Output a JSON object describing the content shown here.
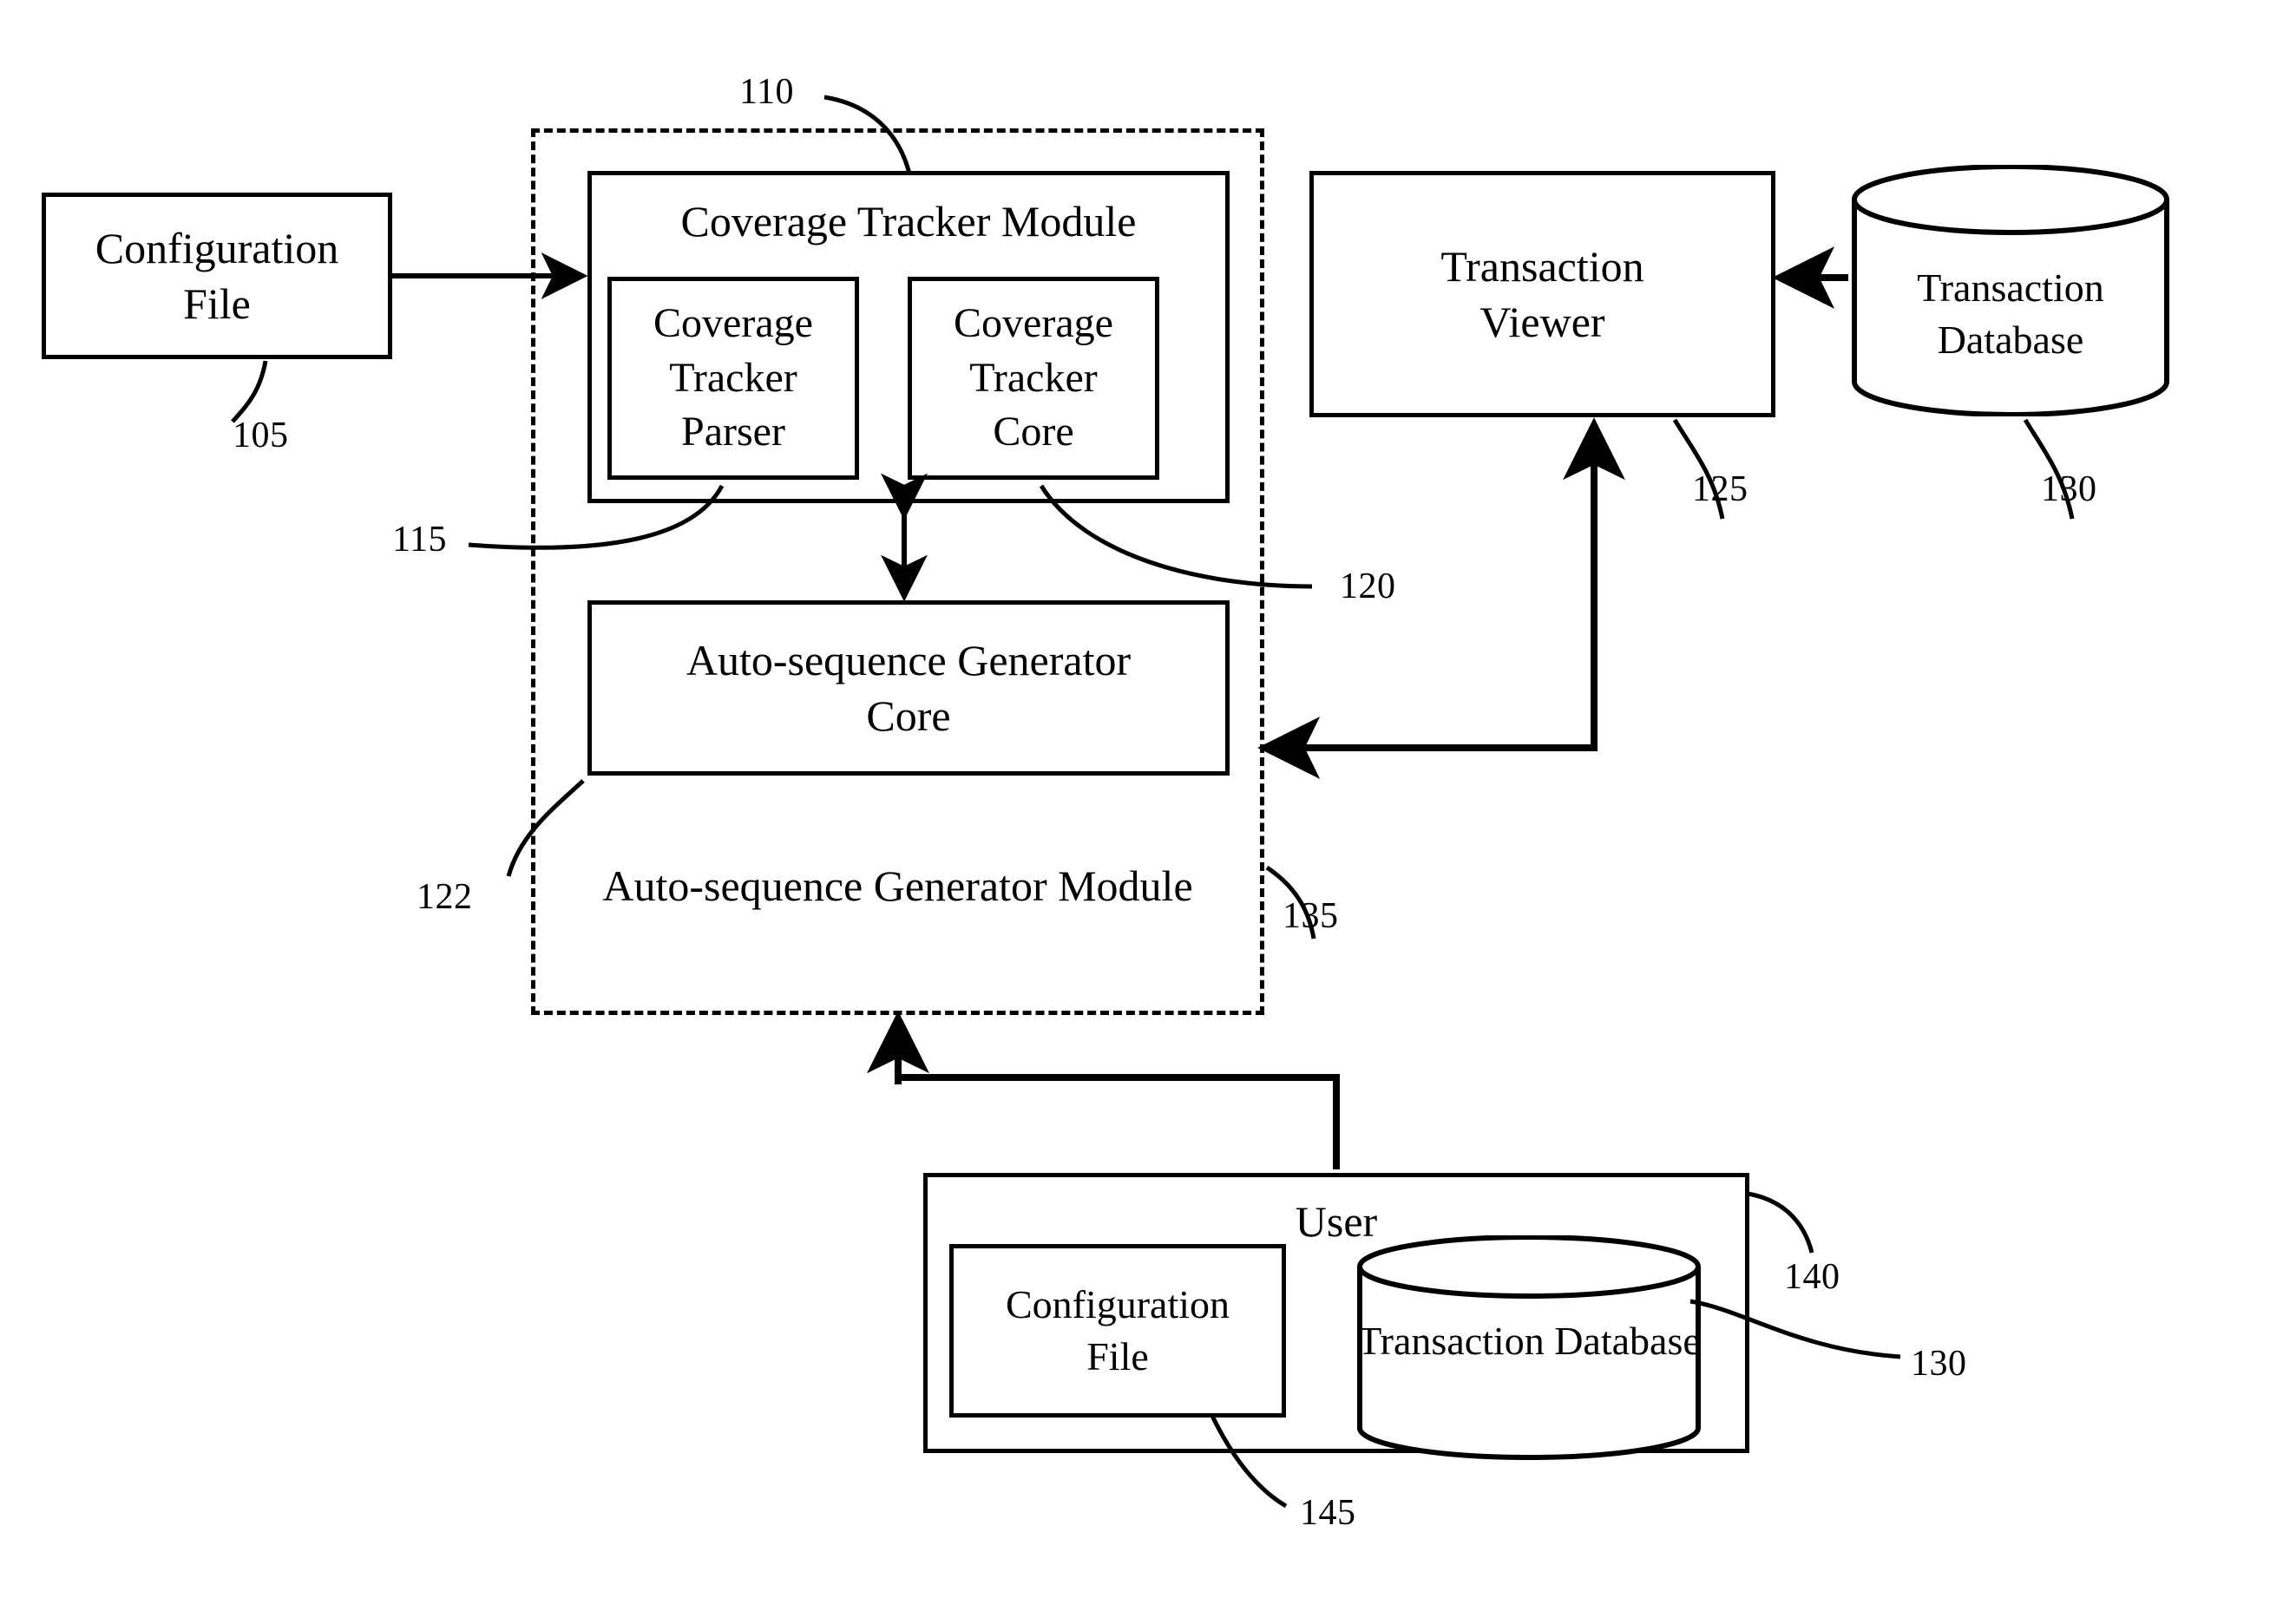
{
  "figure": {
    "type": "patent-block-diagram",
    "background": "#ffffff",
    "stroke": "#000000"
  },
  "blocks": {
    "configuration_file_left": {
      "label": "Configuration\nFile",
      "ref": "105"
    },
    "coverage_tracker_module": {
      "label": "Coverage Tracker Module",
      "ref": "110"
    },
    "coverage_tracker_parser": {
      "label": "Coverage\nTracker\nParser",
      "ref": "115"
    },
    "coverage_tracker_core": {
      "label": "Coverage\nTracker\nCore",
      "ref": "120"
    },
    "auto_sequence_generator_core": {
      "label": "Auto-sequence Generator\nCore",
      "ref": "122"
    },
    "auto_sequence_generator_module": {
      "label": "Auto-sequence Generator\nModule",
      "ref": "135"
    },
    "transaction_viewer": {
      "label": "Transaction\nViewer",
      "ref": "125"
    },
    "transaction_database_top": {
      "label": "Transaction\nDatabase",
      "ref": "130"
    },
    "user": {
      "label": "User",
      "ref": "140"
    },
    "configuration_file_user": {
      "label": "Configuration\nFile",
      "ref": "145"
    },
    "transaction_database_user": {
      "label": "Transaction\nDatabase",
      "ref": "130"
    }
  },
  "reference_numerals": {
    "n105": "105",
    "n110": "110",
    "n115": "115",
    "n120": "120",
    "n122": "122",
    "n125": "125",
    "n130_top": "130",
    "n130_user": "130",
    "n135": "135",
    "n140": "140",
    "n145": "145"
  },
  "connections": [
    {
      "from": "configuration_file_left",
      "to": "coverage_tracker_module",
      "style": "arrow-right"
    },
    {
      "from": "coverage_tracker_module",
      "to": "auto_sequence_generator_core",
      "style": "double-arrow-vertical"
    },
    {
      "from": "transaction_database_top",
      "to": "transaction_viewer",
      "style": "arrow-left"
    },
    {
      "from": "auto_sequence_generator_module",
      "to": "transaction_viewer",
      "style": "elbow-arrow-up-and-left"
    },
    {
      "from": "user",
      "to": "auto_sequence_generator_module",
      "style": "elbow-arrow-up"
    }
  ]
}
